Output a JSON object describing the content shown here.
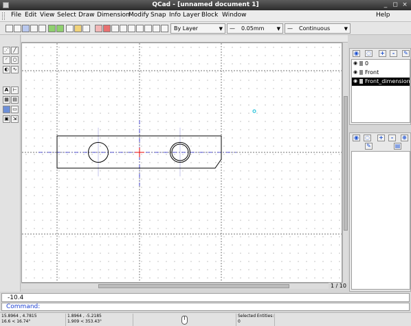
{
  "window": {
    "title": "QCad - [unnamed document 1]"
  },
  "window_buttons": {
    "minimize": "_",
    "restore": "◻",
    "close": "×"
  },
  "menu": {
    "items": [
      "File",
      "Edit",
      "View",
      "Select",
      "Draw",
      "Dimension",
      "Modify",
      "Snap",
      "Info",
      "Layer",
      "Block",
      "Window"
    ],
    "help": "Help"
  },
  "toolbar": {
    "color": "By Layer",
    "width": "0.05mm",
    "linetype": "Continuous"
  },
  "layers": {
    "items": [
      {
        "name": "0",
        "visible": true,
        "locked": false,
        "selected": false
      },
      {
        "name": "Front",
        "visible": true,
        "locked": false,
        "selected": false
      },
      {
        "name": "Front_dimension",
        "visible": true,
        "locked": false,
        "selected": true
      }
    ],
    "add": "+",
    "remove": "-"
  },
  "blocks": {
    "add": "+",
    "remove": "-"
  },
  "canvas": {
    "page_indicator": "1 / 10"
  },
  "command": {
    "history": "-10.4",
    "label": "Command:"
  },
  "status": {
    "abs_coord": "15.8964 , 4.7815",
    "abs_polar": "16.6 < 16.74°",
    "rel_coord": "1.8964 , -5.2185",
    "rel_polar": "1.909 < 353.43°",
    "selected_label": "Selected Entities:",
    "selected_count": "0"
  },
  "colors": {
    "selection": "#000000",
    "cmd_label": "#1b3fd1",
    "center_axis": "#2222cc",
    "center_marker": "#e60000"
  }
}
